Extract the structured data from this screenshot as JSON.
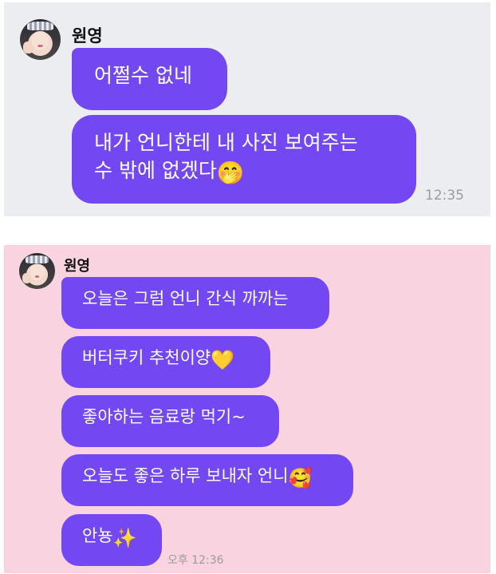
{
  "chat1": {
    "sender_name": "원영",
    "messages": [
      {
        "text": "어쩔수 없네"
      },
      {
        "lines": [
          "내가 언니한테 내 사진 보여주는",
          "수 밖에 없겠다"
        ],
        "emoji": "🤭"
      }
    ],
    "time": "12:35"
  },
  "chat2": {
    "sender_name": "원영",
    "messages": [
      {
        "text": "오늘은 그럼 언니 간식 까까는"
      },
      {
        "text": "버터쿠키 추천이양",
        "emoji": "💛"
      },
      {
        "text": "좋아하는 음료랑 먹기~"
      },
      {
        "text": "오늘도 좋은 하루 보내자 언니",
        "emoji": "🥰"
      },
      {
        "text": "안뇽",
        "emoji": "✨"
      }
    ],
    "time": "오후 12:36"
  },
  "colors": {
    "bubble": "#7348f2",
    "panel1_bg": "#ecedf0",
    "panel2_bg": "#f9d3df"
  }
}
